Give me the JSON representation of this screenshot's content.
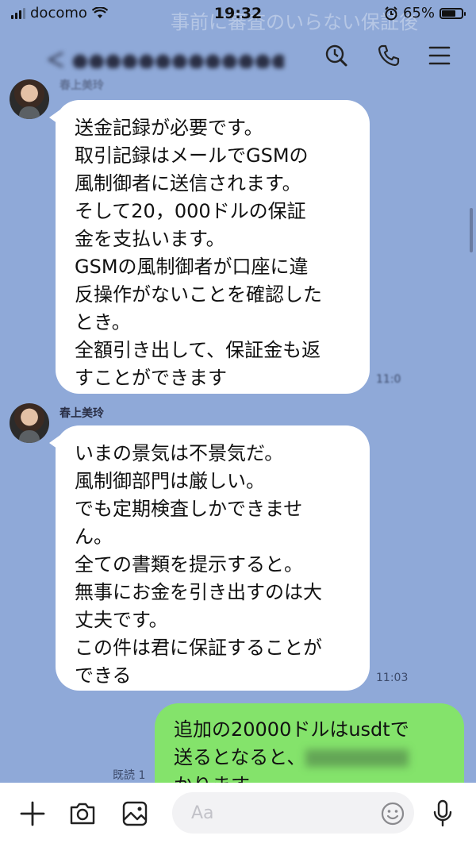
{
  "status_bar": {
    "carrier": "docomo",
    "time": "19:32",
    "battery": "65%"
  },
  "header": {
    "ghost_title": "事前に審査のいらない保証後",
    "chat_name": "＜ ●●●●●●●●●●●●●●●●"
  },
  "messages": [
    {
      "sender": "春上美玲",
      "lines": [
        "送金記録が必要です。",
        "取引記録はメールでGSMの",
        "風制御者に送信されます。",
        "そして20，000ドルの保証",
        "金を支払います。",
        "GSMの風制御者が口座に違",
        "反操作がないことを確認した",
        "とき。",
        "全額引き出して、保証金も返",
        "すことができます"
      ],
      "time": "11:0"
    },
    {
      "sender": "春上美玲",
      "lines": [
        "いまの景気は不景気だ。",
        "風制御部門は厳しい。",
        "でも定期検査しかできませ",
        "ん。",
        "全ての書類を提示すると。",
        "無事にお金を引き出すのは大",
        "丈夫です。",
        "この件は君に保証することが",
        "できる"
      ],
      "time": "11:03"
    }
  ],
  "outgoing": {
    "lines": [
      "追加の20000ドルはusdtで",
      "送るとなると、",
      "かります"
    ],
    "read_label": "既読 1"
  },
  "input": {
    "placeholder": "Aa"
  },
  "icons": {
    "header": [
      "clock-search-icon",
      "phone-icon",
      "menu-icon"
    ],
    "bottom": [
      "plus-icon",
      "camera-icon",
      "image-icon",
      "emoji-icon",
      "microphone-icon"
    ]
  }
}
